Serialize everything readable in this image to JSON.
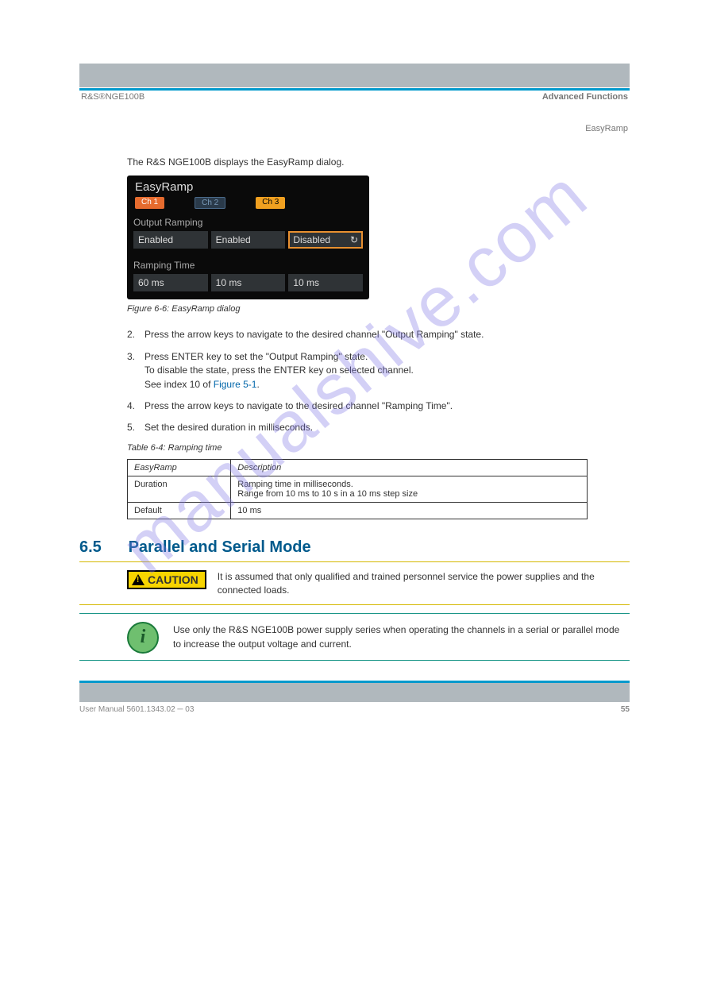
{
  "header": {
    "left": "R&S®NGE100B",
    "right_section": "Advanced Functions",
    "right_sub": "EasyRamp"
  },
  "intro": "The R&S NGE100B displays the EasyRamp dialog.",
  "screenshot": {
    "title": "EasyRamp",
    "channels": [
      "Ch 1",
      "Ch 2",
      "Ch 3"
    ],
    "section1": "Output Ramping",
    "values1": [
      "Enabled",
      "Enabled",
      "Disabled"
    ],
    "section2": "Ramping Time",
    "values2": [
      "60 ms",
      "10 ms",
      "10 ms"
    ]
  },
  "figure_caption": "Figure 6-6: EasyRamp dialog",
  "steps": {
    "s2": {
      "num": "2.",
      "text": "Press the arrow keys to navigate to the desired channel \"Output Ramping\" state."
    },
    "s3": {
      "num": "3.",
      "text": "Press ENTER key to set the \"Output Ramping\" state.\nTo disable the state, press the ENTER key on selected channel.\nSee index 10 of "
    },
    "s3_link": "Figure 5-1",
    "s3_tail": ".",
    "s4": {
      "num": "4.",
      "text": "Press the arrow keys to navigate to the desired channel \"Ramping Time\"."
    },
    "s5": {
      "num": "5.",
      "text": "Set the desired duration in milliseconds."
    }
  },
  "table": {
    "caption": "Table 6-4: Ramping time",
    "rows": [
      [
        "EasyRamp",
        "Description"
      ],
      [
        "Duration",
        "Ramping time in milliseconds.\nRange from 10 ms to 10 s in a 10 ms step size"
      ],
      [
        "Default",
        "10 ms"
      ]
    ]
  },
  "section": {
    "num": "6.5",
    "title": "Parallel and Serial Mode"
  },
  "caution": {
    "label": "CAUTION",
    "text": "It is assumed that only qualified and trained personnel service the power supplies and the connected loads."
  },
  "info": "Use only the R&S NGE100B power supply series when operating the channels in a serial or parallel mode to increase the output voltage and current.",
  "footer": {
    "left": "User Manual 5601.1343.02 ─ 03",
    "right": "55"
  },
  "watermark": "manualshive.com"
}
